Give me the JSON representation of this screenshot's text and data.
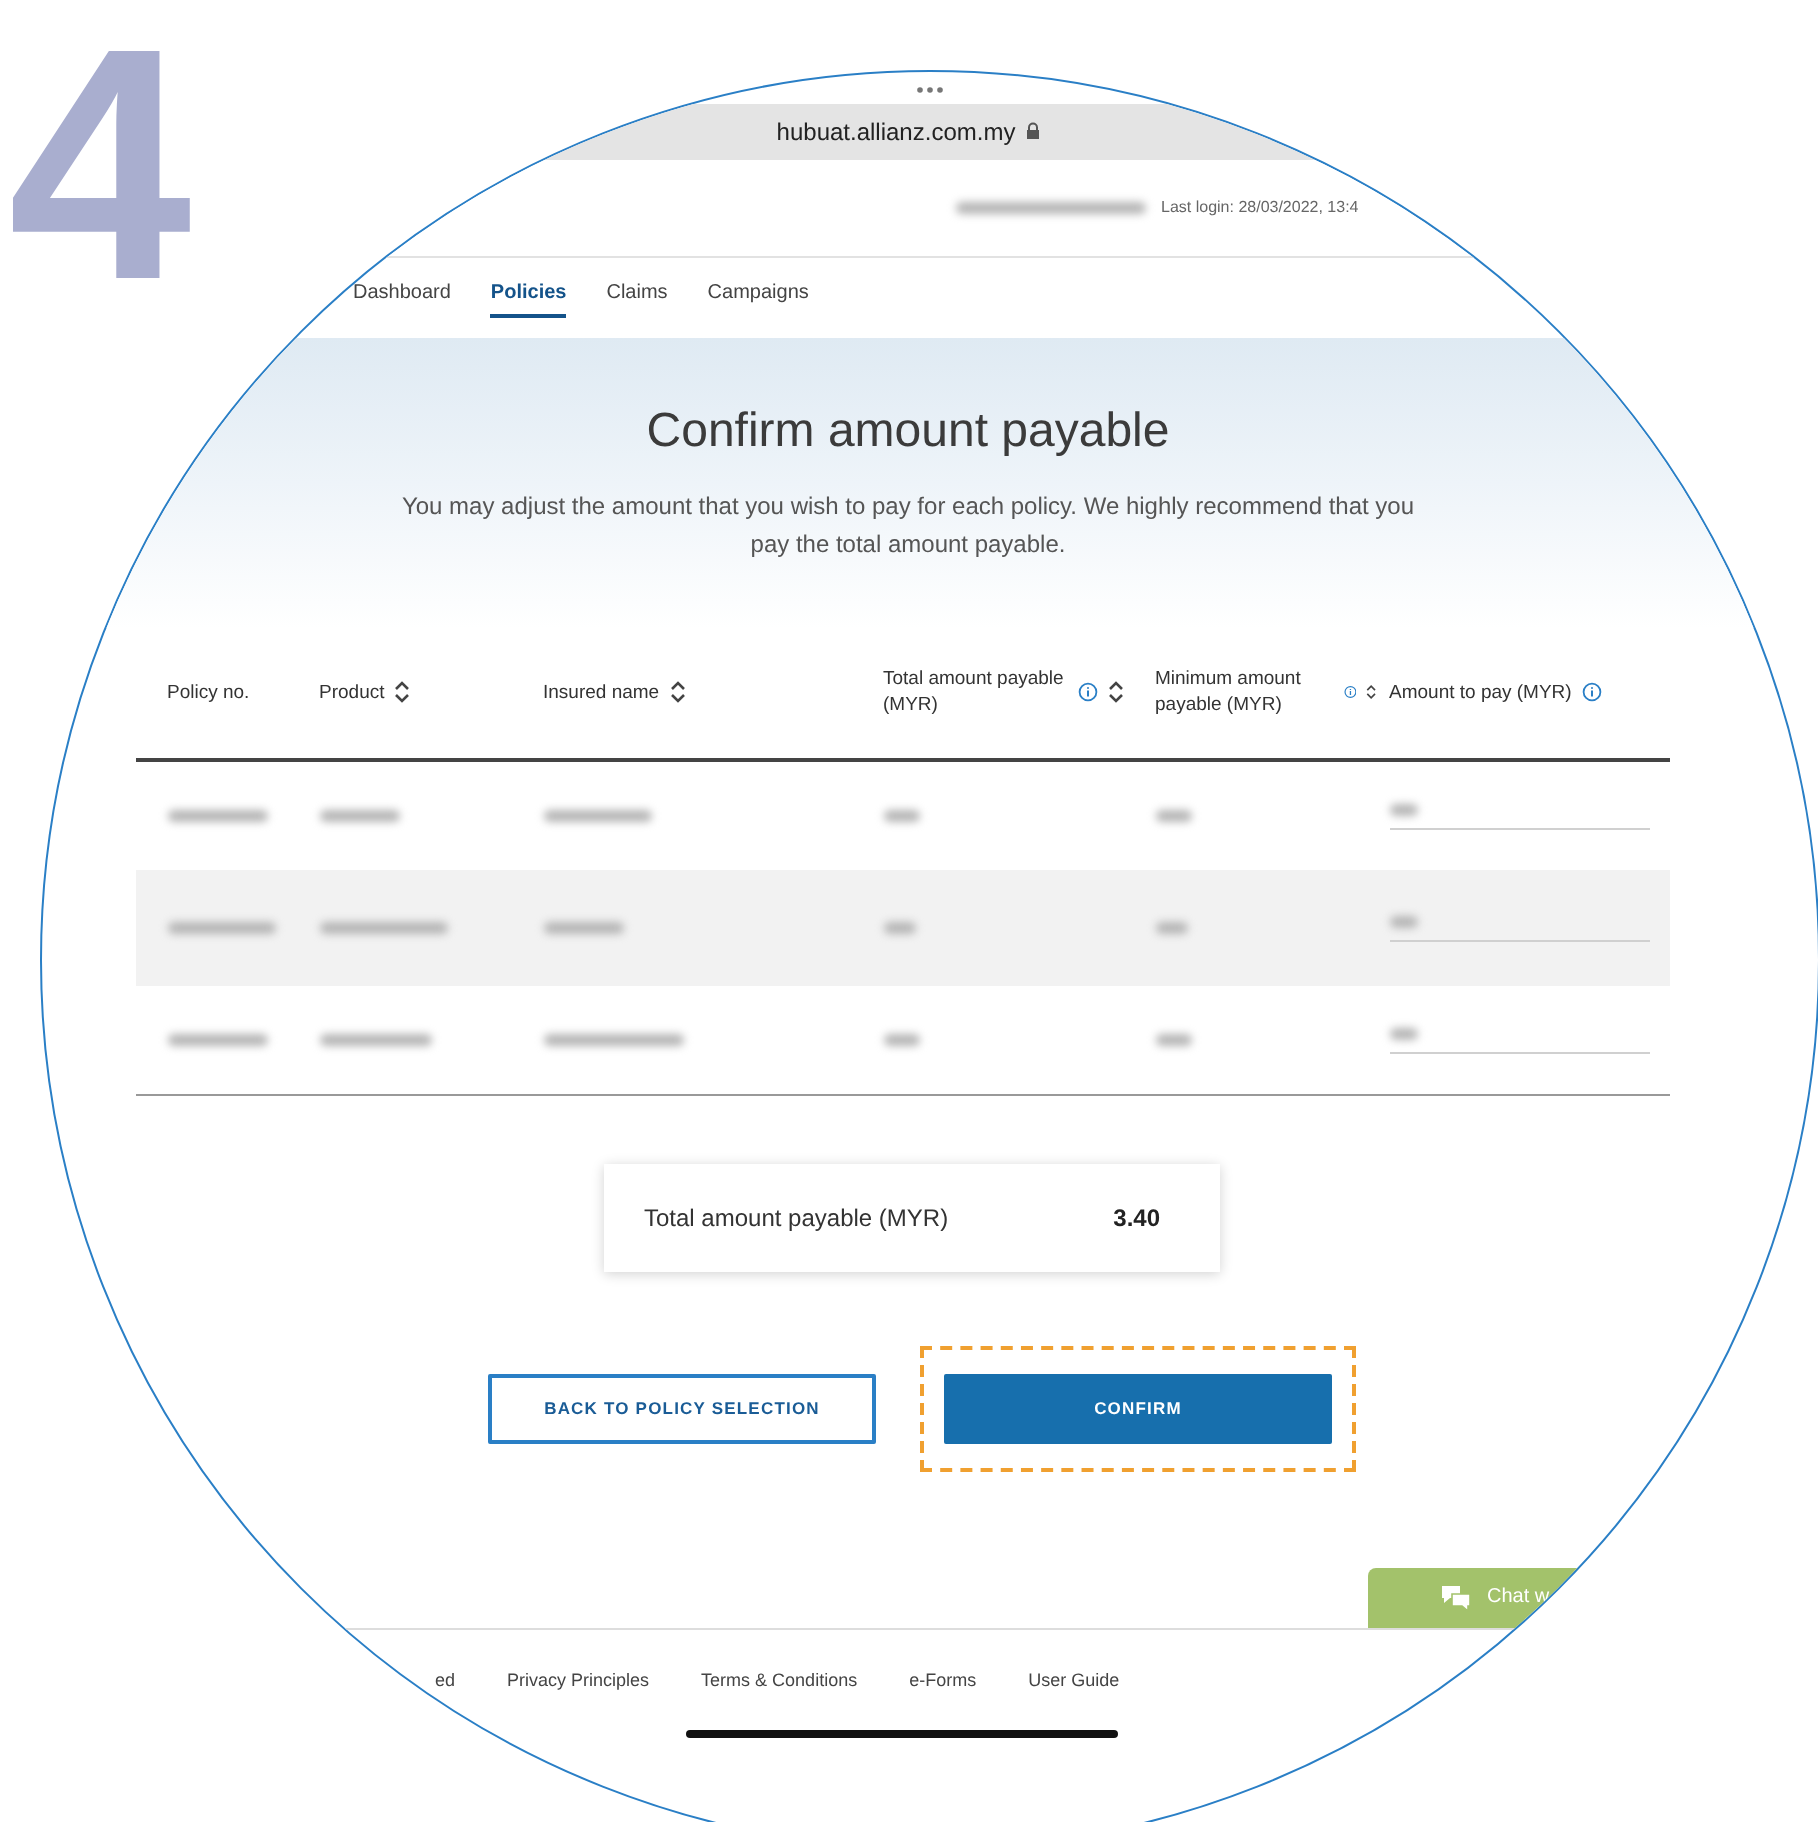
{
  "step_number": "4",
  "browser": {
    "url": "hubuat.allianz.com.my"
  },
  "header": {
    "last_login": "Last login: 28/03/2022, 13:4"
  },
  "nav": [
    {
      "label": "Dashboard",
      "selected": false
    },
    {
      "label": "Policies",
      "selected": true
    },
    {
      "label": "Claims",
      "selected": false
    },
    {
      "label": "Campaigns",
      "selected": false
    }
  ],
  "hero": {
    "title": "Confirm amount payable",
    "subtitle": "You may adjust the amount that you wish to pay for each policy. We highly recommend that you pay the total amount payable."
  },
  "table": {
    "columns": [
      {
        "label": "Policy no.",
        "sortable": false,
        "info": false
      },
      {
        "label": "Product",
        "sortable": true,
        "info": false
      },
      {
        "label": "Insured name",
        "sortable": true,
        "info": false
      },
      {
        "label": "Total amount payable (MYR)",
        "sortable": true,
        "info": true
      },
      {
        "label": "Minimum amount payable (MYR)",
        "sortable": true,
        "info": true
      },
      {
        "label": "Amount to pay (MYR)",
        "sortable": false,
        "info": true
      }
    ],
    "rows": [
      {
        "kind": "redacted",
        "shaded": false
      },
      {
        "kind": "redacted",
        "shaded": true
      },
      {
        "kind": "redacted",
        "shaded": false
      }
    ]
  },
  "total": {
    "label": "Total amount payable (MYR)",
    "value": "3.40"
  },
  "buttons": [
    {
      "label": "BACK TO POLICY SELECTION",
      "kind": "outline",
      "highlighted": false
    },
    {
      "label": "CONFIRM",
      "kind": "primary",
      "highlighted": true
    }
  ],
  "chat": {
    "label": "Chat w"
  },
  "footer": {
    "links": [
      "ed",
      "Privacy Principles",
      "Terms & Conditions",
      "e-Forms",
      "User Guide"
    ]
  }
}
